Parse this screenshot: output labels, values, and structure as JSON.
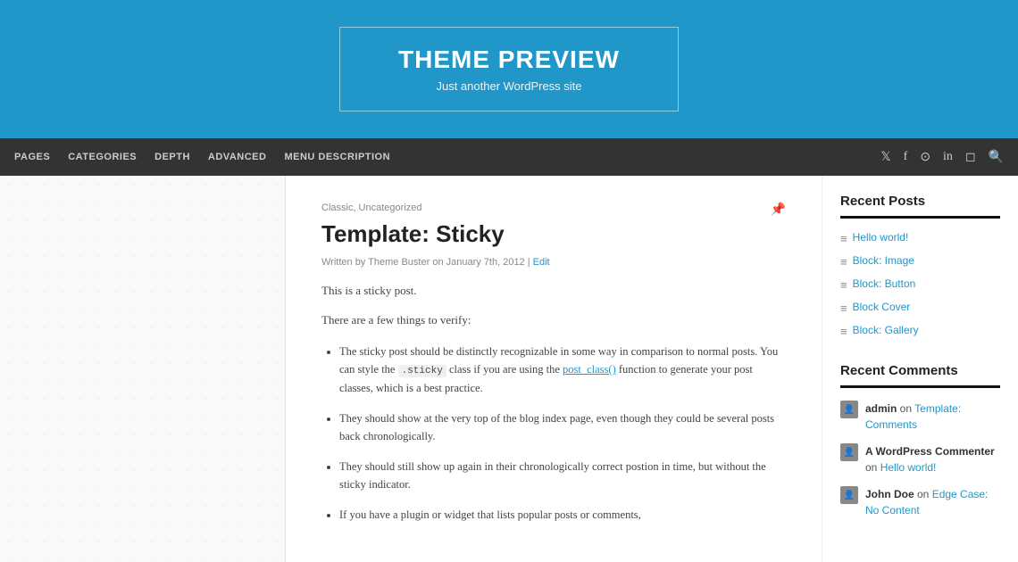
{
  "header": {
    "title": "THEME PREVIEW",
    "tagline": "Just another WordPress site"
  },
  "nav": {
    "links": [
      {
        "label": "PAGES",
        "id": "nav-pages"
      },
      {
        "label": "CATEGORIES",
        "id": "nav-categories"
      },
      {
        "label": "DEPTH",
        "id": "nav-depth"
      },
      {
        "label": "ADVANCED",
        "id": "nav-advanced"
      },
      {
        "label": "MENU DESCRIPTION",
        "id": "nav-menu-description"
      }
    ],
    "social_icons": [
      "twitter",
      "facebook",
      "github",
      "linkedin",
      "instagram",
      "search"
    ]
  },
  "post": {
    "categories": "Classic, Uncategorized",
    "title": "Template: Sticky",
    "meta": "Written by Theme Buster on January 7th, 2012 | Edit",
    "intro": "This is a sticky post.",
    "things_heading": "There are a few things to verify:",
    "bullets": [
      "The sticky post should be distinctly recognizable in some way in comparison to normal posts. You can style the .sticky class if you are using the post_class() function to generate your post classes, which is a best practice.",
      "They should show at the very top of the blog index page, even though they could be several posts back chronologically.",
      "They should still show up again in their chronologically correct postion in time, but without the sticky indicator.",
      "If you have a plugin or widget that lists popular posts or comments,"
    ]
  },
  "sidebar": {
    "recent_posts_title": "Recent Posts",
    "recent_posts": [
      {
        "label": "Hello world!"
      },
      {
        "label": "Block: Image"
      },
      {
        "label": "Block: Button"
      },
      {
        "label": "Block Cover"
      },
      {
        "label": "Block: Gallery"
      }
    ],
    "recent_comments_title": "Recent Comments",
    "recent_comments": [
      {
        "author": "admin",
        "on": "Template: Comments"
      },
      {
        "author": "A WordPress Commenter",
        "on": "Hello world!"
      },
      {
        "author": "John Doe",
        "on": "Edge Case: No Content"
      }
    ]
  }
}
